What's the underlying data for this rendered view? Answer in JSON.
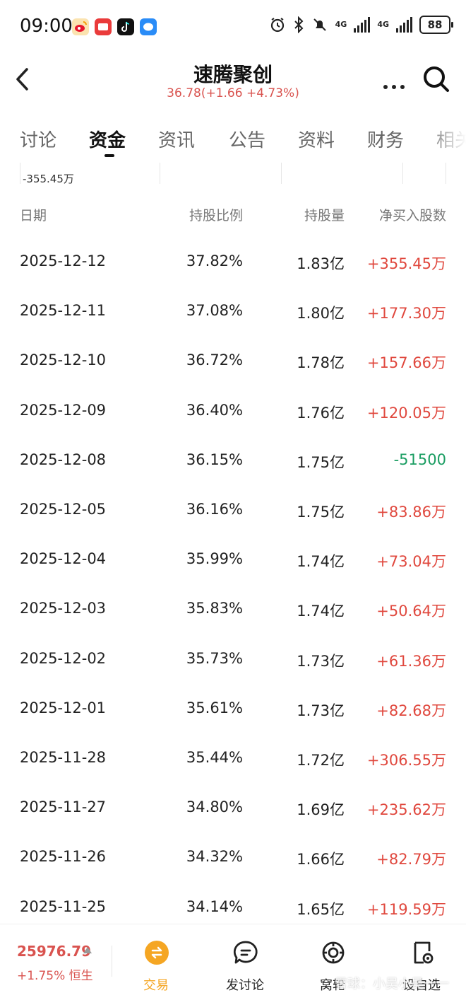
{
  "status_bar": {
    "time": "09:00",
    "network_1": "4G",
    "network_2": "4G",
    "battery": "88",
    "app_icons": [
      "weibo-icon",
      "red-app-icon",
      "tiktok-icon",
      "message-app-icon"
    ]
  },
  "header": {
    "title": "速腾聚创",
    "quote": "36.78(+1.66 +4.73%)"
  },
  "tabs": [
    {
      "label": "讨论",
      "active": false
    },
    {
      "label": "资金",
      "active": true
    },
    {
      "label": "资讯",
      "active": false
    },
    {
      "label": "公告",
      "active": false
    },
    {
      "label": "资料",
      "active": false
    },
    {
      "label": "财务",
      "active": false
    },
    {
      "label": "相关",
      "active": false
    }
  ],
  "chart_residual_label": "-355.45万",
  "table": {
    "headers": [
      "日期",
      "持股比例",
      "持股量",
      "净买入股数"
    ],
    "rows": [
      {
        "date": "2025-12-12",
        "ratio": "37.82%",
        "shares": "1.83亿",
        "net": "+355.45万",
        "dir": "pos"
      },
      {
        "date": "2025-12-11",
        "ratio": "37.08%",
        "shares": "1.80亿",
        "net": "+177.30万",
        "dir": "pos"
      },
      {
        "date": "2025-12-10",
        "ratio": "36.72%",
        "shares": "1.78亿",
        "net": "+157.66万",
        "dir": "pos"
      },
      {
        "date": "2025-12-09",
        "ratio": "36.40%",
        "shares": "1.76亿",
        "net": "+120.05万",
        "dir": "pos"
      },
      {
        "date": "2025-12-08",
        "ratio": "36.15%",
        "shares": "1.75亿",
        "net": "-51500",
        "dir": "neg"
      },
      {
        "date": "2025-12-05",
        "ratio": "36.16%",
        "shares": "1.75亿",
        "net": "+83.86万",
        "dir": "pos"
      },
      {
        "date": "2025-12-04",
        "ratio": "35.99%",
        "shares": "1.74亿",
        "net": "+73.04万",
        "dir": "pos"
      },
      {
        "date": "2025-12-03",
        "ratio": "35.83%",
        "shares": "1.74亿",
        "net": "+50.64万",
        "dir": "pos"
      },
      {
        "date": "2025-12-02",
        "ratio": "35.73%",
        "shares": "1.73亿",
        "net": "+61.36万",
        "dir": "pos"
      },
      {
        "date": "2025-12-01",
        "ratio": "35.61%",
        "shares": "1.73亿",
        "net": "+82.68万",
        "dir": "pos"
      },
      {
        "date": "2025-11-28",
        "ratio": "35.44%",
        "shares": "1.72亿",
        "net": "+306.55万",
        "dir": "pos"
      },
      {
        "date": "2025-11-27",
        "ratio": "34.80%",
        "shares": "1.69亿",
        "net": "+235.62万",
        "dir": "pos"
      },
      {
        "date": "2025-11-26",
        "ratio": "34.32%",
        "shares": "1.66亿",
        "net": "+82.79万",
        "dir": "pos"
      },
      {
        "date": "2025-11-25",
        "ratio": "34.14%",
        "shares": "1.65亿",
        "net": "+119.59万",
        "dir": "pos"
      }
    ]
  },
  "bottom_bar": {
    "index_value": "25976.79",
    "index_change": "+1.75% 恒生",
    "nav": [
      {
        "label": "交易",
        "icon": "trade-icon"
      },
      {
        "label": "发讨论",
        "icon": "post-discussion-icon"
      },
      {
        "label": "窝轮",
        "icon": "warrant-icon"
      },
      {
        "label": "设自选",
        "icon": "add-watchlist-icon"
      }
    ],
    "watermark": "雪球：小吴小吴一一"
  },
  "colors": {
    "up": "#e0483e",
    "down": "#1a9d62",
    "accent": "#f5a623"
  }
}
